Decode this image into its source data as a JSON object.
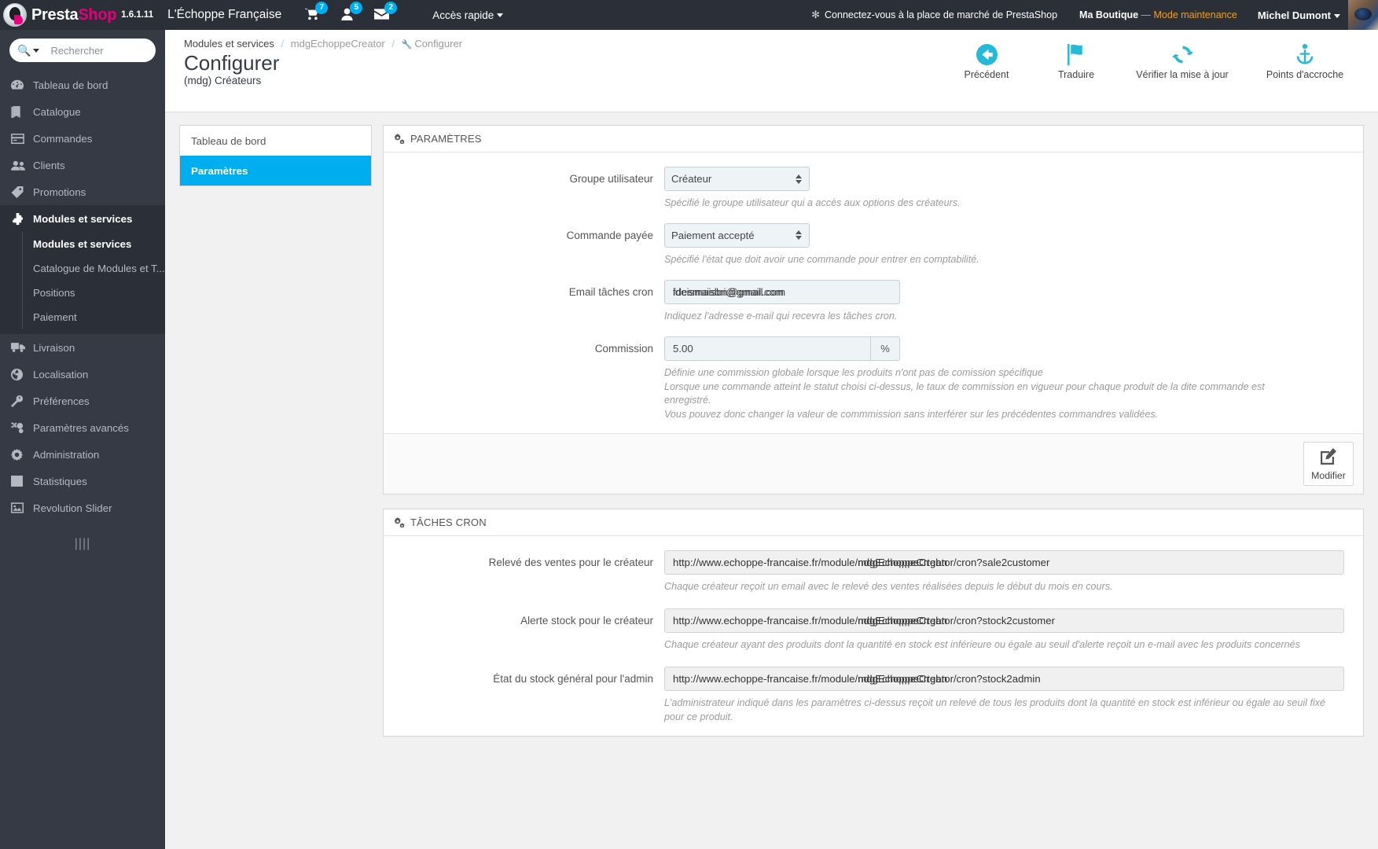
{
  "topbar": {
    "brand_presta": "Presta",
    "brand_shop": "Shop",
    "version": "1.6.1.11",
    "shop_name": "L'Échoppe Française",
    "badges": [
      {
        "icon": "cart-icon",
        "count": "7"
      },
      {
        "icon": "customer-icon",
        "count": "5"
      },
      {
        "icon": "envelope-icon",
        "count": "2"
      }
    ],
    "quick_access": "Accès rapide",
    "marketplace": "Connectez-vous à la place de marché de PrestaShop",
    "shop_label": "Ma Boutique",
    "maintenance": "— Mode maintenance",
    "user_name": "Michel Dumont"
  },
  "sidebar": {
    "search_placeholder": "Rechercher",
    "items": [
      {
        "label": "Tableau de bord",
        "icon": "dashboard-icon"
      },
      {
        "label": "Catalogue",
        "icon": "catalog-icon"
      },
      {
        "label": "Commandes",
        "icon": "orders-icon"
      },
      {
        "label": "Clients",
        "icon": "customers-icon"
      },
      {
        "label": "Promotions",
        "icon": "promotions-icon"
      },
      {
        "label": "Modules et services",
        "icon": "modules-icon"
      },
      {
        "label": "Livraison",
        "icon": "shipping-icon"
      },
      {
        "label": "Localisation",
        "icon": "localization-icon"
      },
      {
        "label": "Préférences",
        "icon": "preferences-icon"
      },
      {
        "label": "Paramètres avancés",
        "icon": "advanced-params-icon"
      },
      {
        "label": "Administration",
        "icon": "administration-icon"
      },
      {
        "label": "Statistiques",
        "icon": "statistics-icon"
      },
      {
        "label": "Revolution Slider",
        "icon": "slider-icon"
      }
    ],
    "submenu": [
      "Modules et services",
      "Catalogue de Modules et T...",
      "Positions",
      "Paiement"
    ],
    "collapse_handle": "||||"
  },
  "page": {
    "breadcrumb": {
      "first": "Modules et services",
      "second": "mdgEchoppeCreator",
      "current": "Configurer",
      "separator": "/"
    },
    "title": "Configurer",
    "subtitle": "(mdg) Créateurs"
  },
  "toolbar": [
    {
      "label": "Précédent",
      "icon": "back-arrow-icon"
    },
    {
      "label": "Traduire",
      "icon": "flag-icon"
    },
    {
      "label": "Vérifier la mise à jour",
      "icon": "refresh-icon"
    },
    {
      "label": "Points d'accroche",
      "icon": "anchor-icon"
    }
  ],
  "left_tabs": [
    {
      "label": "Tableau de bord",
      "active": false
    },
    {
      "label": "Paramètres",
      "active": true
    }
  ],
  "settings_panel": {
    "title": "PARAMÈTRES",
    "icon": "gears-icon",
    "fields": [
      {
        "label": "Groupe utilisateur",
        "type": "select",
        "value": "Créateur",
        "options": [
          "Créateur"
        ],
        "help": "Spécifié le groupe utilisateur qui a accès aux options des créateurs."
      },
      {
        "label": "Commande payée",
        "type": "select",
        "value": "Paiement accepté",
        "options": [
          "Paiement accepté"
        ],
        "help": "Spécifié l'état que doit avoir une commande pour entrer en comptabilité."
      },
      {
        "label": "Email tâches cron",
        "type": "email",
        "value": "fdesmaisbri@gmail.com",
        "overlay_value": "ideismaisbn@gmail.com",
        "help": "Indiquez l'adresse e-mail qui recevra les tâches cron."
      },
      {
        "label": "Commission",
        "type": "number-addon",
        "value": "5.00",
        "addon": "%",
        "help": "Définie une commission globale lorsque les produits n'ont pas de comission spécifique\nLorsque une commande atteint le statut choisi ci-dessus, le taux de commission en vigueur pour chaque produit de la dite commande est enregistré.\nVous pouvez donc changer la valeur de commmission sans interférer sur les précédentes commandres validées."
      }
    ],
    "edit_button": {
      "label": "Modifier",
      "icon": "pencil-square-icon"
    }
  },
  "cron_panel": {
    "title": "TÂCHES CRON",
    "icon": "gears-icon",
    "rows": [
      {
        "label": "Relevé des ventes pour le créateur",
        "url_prefix": "http://www.echoppe-francaise.fr/module/",
        "url_module_a": "mdgEchoppeCreator",
        "url_module_b": "ndgEchoppeCrtgbn",
        "url_suffix": "/cron?sale2customer",
        "help": "Chaque créateur reçoit un email avec le relevé des ventes réalisées depuis le début du mois en cours."
      },
      {
        "label": "Alerte stock pour le créateur",
        "url_prefix": "http://www.echoppe-francaise.fr/module/",
        "url_module_a": "mdgEchoppeCreator",
        "url_module_b": "ndgEchoppeCrtgbn",
        "url_suffix": "/cron?stock2customer",
        "help": "Chaque créateur ayant des produits dont la quantité en stock est inférieure ou égale au seuil d'alerte reçoit un e-mail avec les produits concernés"
      },
      {
        "label": "État du stock général pour l'admin",
        "url_prefix": "http://www.echoppe-francaise.fr/module/",
        "url_module_a": "mdgEchoppeCreator",
        "url_module_b": "ndgEchoppeCrtgbn",
        "url_suffix": "/cron?stock2admin",
        "help": "L'administrateur indiqué dans les paramètres ci-dessus reçoit un relevé de tous les produits dont la quantité en stock est inférieur ou égale au seuil fixé pour ce produit."
      }
    ]
  },
  "colors": {
    "accent_cyan": "#00aeef",
    "toolbar_icon": "#25b9d7",
    "brand_pink": "#e4007a",
    "topbar_bg": "#2b2f38",
    "sidebar_bg": "#363a45",
    "maintenance_orange": "#f2a01a"
  }
}
